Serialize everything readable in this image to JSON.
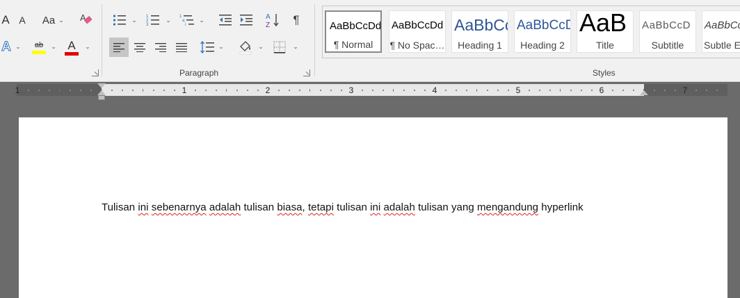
{
  "font_group": {
    "grow_font": "A",
    "shrink_font": "A",
    "change_case": "Aa",
    "text_effects": "A",
    "font_color_letter": "A",
    "highlight_letters": "ab"
  },
  "paragraph_group": {
    "label": "Paragraph",
    "sort_label": "A↓Z",
    "pilcrow": "¶"
  },
  "styles_group": {
    "label": "Styles",
    "items": [
      {
        "preview": "AaBbCcDd",
        "name": "¶ Normal",
        "selected": true
      },
      {
        "preview": "AaBbCcDd",
        "name": "¶ No Spac…",
        "selected": false
      },
      {
        "preview": "AaBbCc",
        "name": "Heading 1",
        "selected": false
      },
      {
        "preview": "AaBbCcD",
        "name": "Heading 2",
        "selected": false
      },
      {
        "preview": "AaB",
        "name": "Title",
        "selected": false
      },
      {
        "preview": "AaBbCcD",
        "name": "Subtitle",
        "selected": false
      },
      {
        "preview": "AaBbCcD",
        "name": "Subtle E",
        "selected": false
      }
    ]
  },
  "ruler": {
    "labels": [
      "1",
      "1",
      "2",
      "3",
      "4",
      "5",
      "6",
      "7"
    ]
  },
  "document": {
    "words": [
      {
        "text": "Tulisan ",
        "misspelled": false
      },
      {
        "text": "ini",
        "misspelled": true
      },
      {
        "text": " ",
        "misspelled": false
      },
      {
        "text": "sebenarnya",
        "misspelled": true
      },
      {
        "text": " ",
        "misspelled": false
      },
      {
        "text": "adalah",
        "misspelled": true
      },
      {
        "text": " tulisan ",
        "misspelled": false
      },
      {
        "text": "biasa",
        "misspelled": true
      },
      {
        "text": ", ",
        "misspelled": false
      },
      {
        "text": "tetapi",
        "misspelled": true
      },
      {
        "text": " tulisan ",
        "misspelled": false
      },
      {
        "text": "ini",
        "misspelled": true
      },
      {
        "text": " ",
        "misspelled": false
      },
      {
        "text": "adalah",
        "misspelled": true
      },
      {
        "text": " tulisan yang ",
        "misspelled": false
      },
      {
        "text": "mengandung",
        "misspelled": true
      },
      {
        "text": " hyperlink",
        "misspelled": false
      }
    ]
  },
  "colors": {
    "highlight": "#ffff00",
    "font_color": "#e00000",
    "text_effects": "#2e74b5",
    "heading_blue": "#2e5597"
  }
}
